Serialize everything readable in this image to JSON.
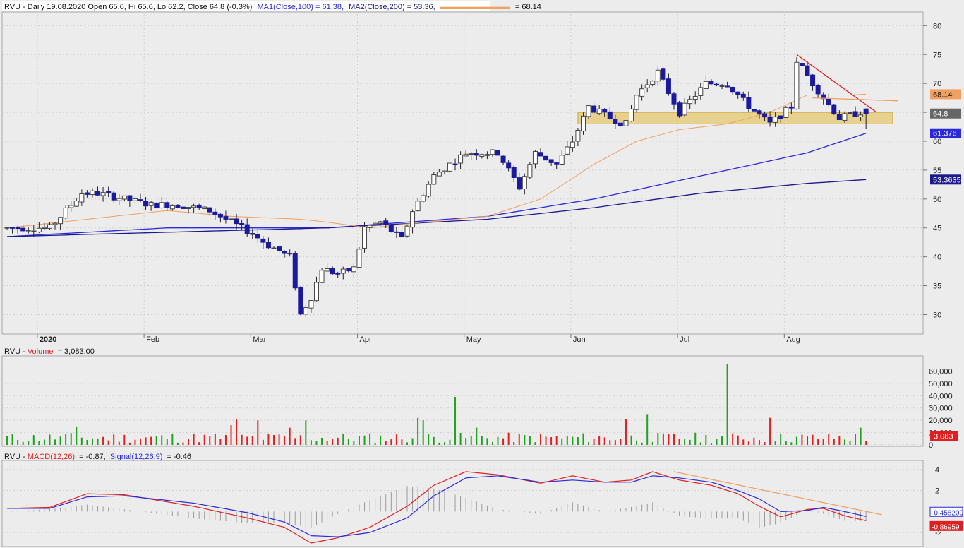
{
  "header": {
    "symbol": "RVU",
    "price_line": "RVU - Daily 19.08.2020 Open 65.6, Hi 65.6, Lo 62.2, Close 64.8 (-0.3%)",
    "ma1_label": "MA1(Close,100) = 61.38,",
    "ma2_label": "MA2(Close,200) = 53.36,",
    "ma3_value_label": "= 68.14"
  },
  "volume_header": {
    "prefix": "RVU - ",
    "name": "Volume",
    "value": "= 3,083.00"
  },
  "macd_header": {
    "prefix": "RVU - ",
    "macd": "MACD(12,26)",
    "macd_value": "= -0.87,",
    "signal": "Signal(12,26,9)",
    "signal_value": "= -0.46"
  },
  "colors": {
    "background": "#ececec",
    "candle_down": "#1a1aa0",
    "candle_up": "#ffffff",
    "ma_blue": "#2a2adc",
    "ma_navy": "#1a1a8c",
    "ma_orange": "#f0a060",
    "trend_red": "#e02020",
    "zone": "#e6c870",
    "vol_up": "#22a022",
    "vol_down": "#e02020",
    "macd": "#e02020",
    "signal": "#2a2adc"
  },
  "chart_data": [
    {
      "type": "candlestick",
      "title": "RVU - Daily 19.08.2020",
      "ylim": [
        27,
        82
      ],
      "y_ticks": [
        30,
        35,
        40,
        45,
        50,
        55,
        60,
        65,
        70,
        75,
        80
      ],
      "x_tick_labels": [
        "2020",
        "Feb",
        "Mar",
        "Apr",
        "May",
        "Jun",
        "Jul",
        "Aug"
      ],
      "x_tick_index": [
        7,
        27,
        47,
        67,
        87,
        107,
        127,
        147
      ],
      "n_bars": 162,
      "anchors": [
        [
          0,
          45
        ],
        [
          8,
          45
        ],
        [
          10,
          47
        ],
        [
          14,
          51
        ],
        [
          17,
          51
        ],
        [
          22,
          50
        ],
        [
          27,
          49
        ],
        [
          32,
          49
        ],
        [
          38,
          48
        ],
        [
          42,
          46
        ],
        [
          46,
          44
        ],
        [
          49,
          42
        ],
        [
          53,
          40
        ],
        [
          55,
          30
        ],
        [
          57,
          33
        ],
        [
          59,
          38
        ],
        [
          62,
          37
        ],
        [
          65,
          38
        ],
        [
          67,
          45
        ],
        [
          70,
          46
        ],
        [
          74,
          43
        ],
        [
          76,
          48
        ],
        [
          80,
          54
        ],
        [
          86,
          58
        ],
        [
          92,
          58
        ],
        [
          96,
          52
        ],
        [
          99,
          58
        ],
        [
          103,
          56
        ],
        [
          106,
          60
        ],
        [
          109,
          66
        ],
        [
          113,
          64
        ],
        [
          116,
          63
        ],
        [
          118,
          68
        ],
        [
          122,
          72
        ],
        [
          126,
          65
        ],
        [
          131,
          70
        ],
        [
          135,
          70
        ],
        [
          139,
          66
        ],
        [
          143,
          63
        ],
        [
          147,
          66
        ],
        [
          148,
          74
        ],
        [
          151,
          70
        ],
        [
          156,
          64
        ],
        [
          160,
          65
        ],
        [
          161,
          64.8
        ]
      ],
      "last_bar": {
        "open": 65.6,
        "high": 65.6,
        "low": 62.2,
        "close": 64.8
      },
      "series": [
        {
          "name": "MA1(Close,100)",
          "last": 61.38,
          "anchors": [
            [
              0,
              43.5
            ],
            [
              30,
              45
            ],
            [
              60,
              45
            ],
            [
              90,
              47
            ],
            [
              110,
              50
            ],
            [
              130,
              54
            ],
            [
              150,
              58
            ],
            [
              161,
              61.38
            ]
          ]
        },
        {
          "name": "MA2(Close,200)",
          "last": 53.36,
          "anchors": [
            [
              0,
              43.5
            ],
            [
              40,
              44.5
            ],
            [
              60,
              45
            ],
            [
              90,
              46.5
            ],
            [
              110,
              48.5
            ],
            [
              130,
              51
            ],
            [
              150,
              52.7
            ],
            [
              161,
              53.36
            ]
          ]
        },
        {
          "name": "MA",
          "last": 68.14,
          "anchors": [
            [
              0,
              45
            ],
            [
              30,
              48
            ],
            [
              42,
              47
            ],
            [
              55,
              46.5
            ],
            [
              60,
              46
            ],
            [
              68,
              45
            ],
            [
              78,
              46
            ],
            [
              90,
              47
            ],
            [
              100,
              50
            ],
            [
              110,
              56
            ],
            [
              118,
              60
            ],
            [
              126,
              62
            ],
            [
              135,
              63
            ],
            [
              143,
              65
            ],
            [
              150,
              68
            ],
            [
              158,
              68
            ],
            [
              161,
              68.14
            ]
          ]
        }
      ],
      "price_labels": [
        {
          "text": "68.14",
          "value": 68.14,
          "color": "#f0a060"
        },
        {
          "text": "64.8",
          "value": 64.8,
          "color": "#666666"
        },
        {
          "text": "61.376",
          "value": 61.376,
          "color": "#2a2adc"
        },
        {
          "text": "53.3635",
          "value": 53.3635,
          "color": "#1a1a8c"
        }
      ],
      "support_zone": {
        "y_low": 63,
        "y_high": 65,
        "x_start": 107,
        "x_end": 166
      },
      "trend_lines": [
        {
          "color": "#e02020",
          "points": [
            [
              148,
              75
            ],
            [
              163,
              65
            ]
          ]
        },
        {
          "color": "#f0a060",
          "points": [
            [
              151,
              67.5
            ],
            [
              167,
              67
            ]
          ]
        }
      ]
    },
    {
      "type": "bar",
      "name": "Volume",
      "ylim": [
        0,
        70000
      ],
      "y_tick_labels": [
        "0",
        "10,000",
        "20,000",
        "30,000",
        "40,000",
        "50,000",
        "60,000"
      ],
      "y_ticks": [
        0,
        10000,
        20000,
        30000,
        40000,
        50000,
        60000
      ],
      "last": 3083,
      "last_label": "3,083",
      "spikes": [
        [
          13,
          15000
        ],
        [
          42,
          16000
        ],
        [
          43,
          21000
        ],
        [
          47,
          20000
        ],
        [
          53,
          14000
        ],
        [
          56,
          20000
        ],
        [
          77,
          22000
        ],
        [
          78,
          20000
        ],
        [
          84,
          39000
        ],
        [
          88,
          14000
        ],
        [
          116,
          21000
        ],
        [
          120,
          25000
        ],
        [
          135,
          66000
        ],
        [
          143,
          22000
        ],
        [
          160,
          14000
        ]
      ]
    },
    {
      "type": "line",
      "name": "MACD",
      "ylim": [
        -3.2,
        4.6
      ],
      "y_tick_labels": [
        "-2",
        "2",
        "4"
      ],
      "y_ticks": [
        -2,
        2,
        4
      ],
      "series": [
        {
          "name": "MACD(12,26)",
          "last": -0.87,
          "anchors": [
            [
              0,
              0.3
            ],
            [
              8,
              0.4
            ],
            [
              15,
              1.7
            ],
            [
              22,
              1.6
            ],
            [
              35,
              0.5
            ],
            [
              45,
              -0.6
            ],
            [
              52,
              -1.5
            ],
            [
              57,
              -3.0
            ],
            [
              62,
              -2.5
            ],
            [
              68,
              -1.5
            ],
            [
              75,
              0.5
            ],
            [
              80,
              2.5
            ],
            [
              86,
              3.8
            ],
            [
              92,
              3.5
            ],
            [
              100,
              2.7
            ],
            [
              106,
              3.4
            ],
            [
              112,
              2.8
            ],
            [
              117,
              3.0
            ],
            [
              121,
              3.8
            ],
            [
              126,
              3.0
            ],
            [
              132,
              2.5
            ],
            [
              137,
              1.7
            ],
            [
              141,
              0.5
            ],
            [
              145,
              -0.5
            ],
            [
              150,
              0.2
            ],
            [
              153,
              0.3
            ],
            [
              157,
              -0.4
            ],
            [
              161,
              -0.87
            ]
          ]
        },
        {
          "name": "Signal(12,26,9)",
          "last": -0.46,
          "anchors": [
            [
              0,
              0.3
            ],
            [
              8,
              0.3
            ],
            [
              15,
              1.4
            ],
            [
              22,
              1.5
            ],
            [
              35,
              0.8
            ],
            [
              45,
              -0.1
            ],
            [
              52,
              -1.0
            ],
            [
              57,
              -2.3
            ],
            [
              62,
              -2.4
            ],
            [
              68,
              -2.0
            ],
            [
              75,
              -0.6
            ],
            [
              80,
              1.5
            ],
            [
              86,
              3.2
            ],
            [
              92,
              3.4
            ],
            [
              100,
              2.8
            ],
            [
              106,
              3.0
            ],
            [
              112,
              2.8
            ],
            [
              117,
              2.8
            ],
            [
              121,
              3.4
            ],
            [
              126,
              3.2
            ],
            [
              132,
              2.8
            ],
            [
              137,
              2.0
            ],
            [
              141,
              1.2
            ],
            [
              145,
              0.0
            ],
            [
              150,
              0.1
            ],
            [
              153,
              0.4
            ],
            [
              157,
              0.0
            ],
            [
              161,
              -0.46
            ]
          ]
        }
      ],
      "value_labels": [
        {
          "text": "-0.458209",
          "value": -0.46,
          "color": "#2a2adc"
        },
        {
          "text": "-0.86959",
          "value": -0.87,
          "color": "#e02020"
        }
      ],
      "trend_line": {
        "color": "#f0a060",
        "points": [
          [
            125,
            3.8
          ],
          [
            164,
            -0.3
          ]
        ]
      }
    }
  ]
}
